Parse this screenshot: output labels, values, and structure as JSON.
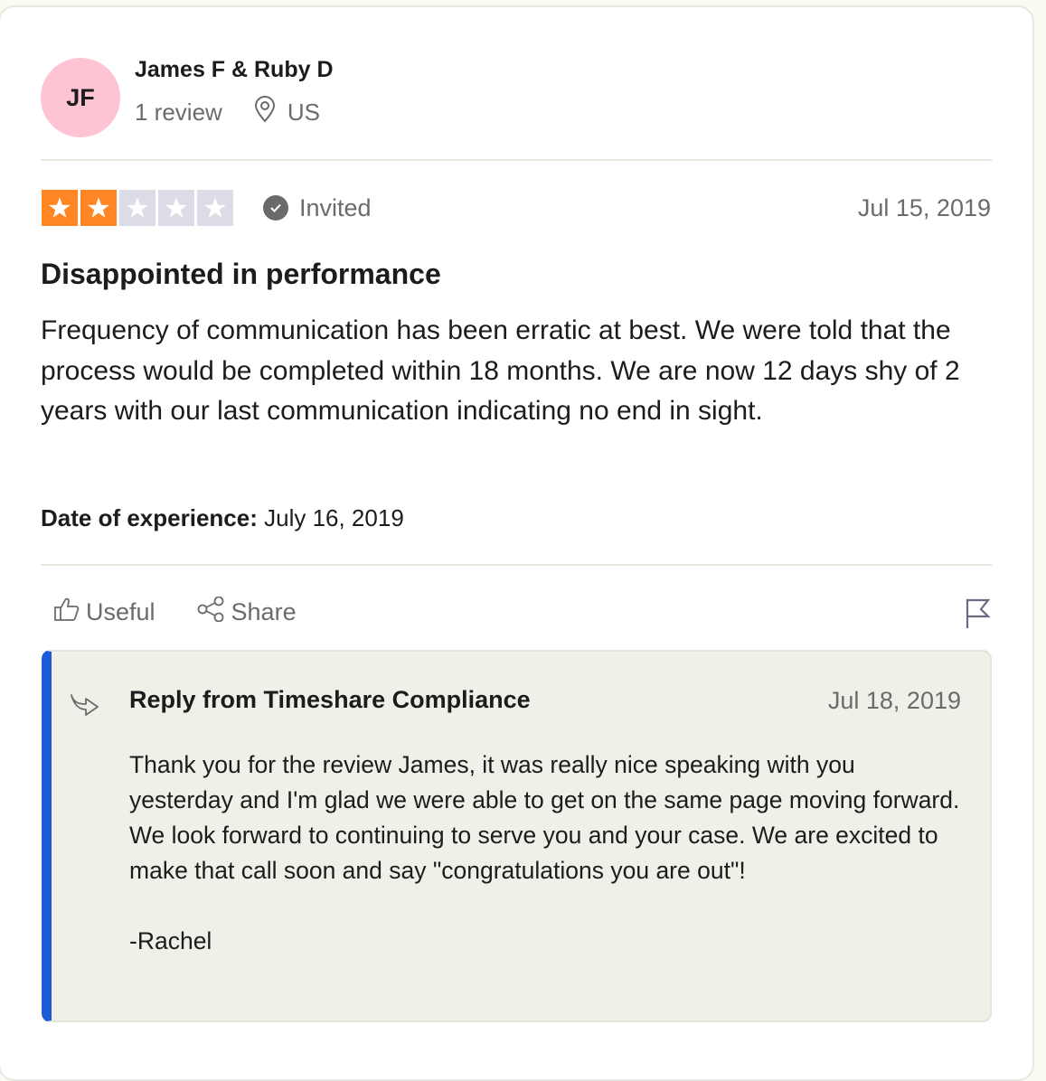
{
  "consumer": {
    "initials": "JF",
    "avatar_color": "#ffc4d4",
    "name": "James F & Ruby D",
    "review_count": "1 review",
    "location_icon": "location-pin-icon",
    "location": "US"
  },
  "review": {
    "rating": 2,
    "rating_max": 5,
    "star_on_color": "#ff8622",
    "star_off_color": "#dcdce6",
    "invited_label": "Invited",
    "date": "Jul 15, 2019",
    "title": "Disappointed in performance",
    "body": "Frequency of communication has been erratic at best. We were told that the process would be completed within 18 months. We are now 12 days shy of 2 years with our last communication indicating no end in sight.",
    "date_of_experience_label": "Date of experience:",
    "date_of_experience": "July 16, 2019"
  },
  "actions": {
    "useful_label": "Useful",
    "share_label": "Share",
    "report_icon": "flag-icon"
  },
  "reply": {
    "accent_color": "#1c5bd8",
    "title": "Reply from Timeshare Compliance",
    "date": "Jul 18, 2019",
    "body": "Thank you for the review James, it was really nice speaking with you yesterday and I'm glad we were able to get on the same page moving forward. We look forward to continuing to serve you and your case. We are excited to make that call soon and say \"congratulations you are out\"!\n\n-Rachel"
  }
}
